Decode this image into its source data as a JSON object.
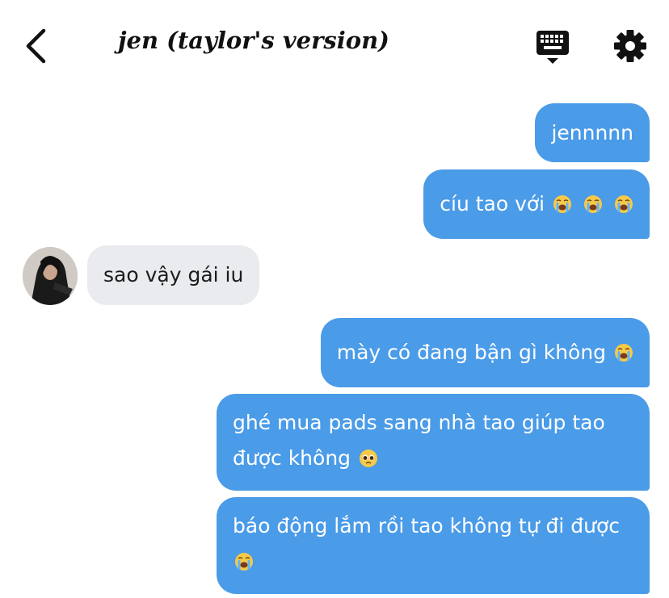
{
  "header": {
    "title": "jen (taylor's version)",
    "back_icon": "chevron-left-icon",
    "keyboard_icon": "keyboard-icon",
    "settings_icon": "gear-icon"
  },
  "messages": [
    {
      "sender": "me",
      "text": "jennnnn",
      "emoji": []
    },
    {
      "sender": "me",
      "text": "cíu tao với",
      "emoji": [
        "loudly-crying-face",
        "loudly-crying-face",
        "loudly-crying-face"
      ]
    },
    {
      "sender": "jen",
      "text": "sao vậy gái iu",
      "emoji": []
    },
    {
      "sender": "me",
      "text": "mày có đang bận gì không",
      "emoji": [
        "loudly-crying-face"
      ]
    },
    {
      "sender": "me",
      "text": "ghé mua pads sang nhà tao giúp tao được không",
      "emoji": [
        "pleading-face"
      ]
    },
    {
      "sender": "me",
      "text": "báo động lắm rồi tao không tự đi được",
      "emoji": [
        "loudly-crying-face"
      ]
    }
  ],
  "colors": {
    "sent_bubble": "#4a9be8",
    "received_bubble": "#e9ebee",
    "sent_text": "#ffffff",
    "received_text": "#1c1c1e"
  }
}
